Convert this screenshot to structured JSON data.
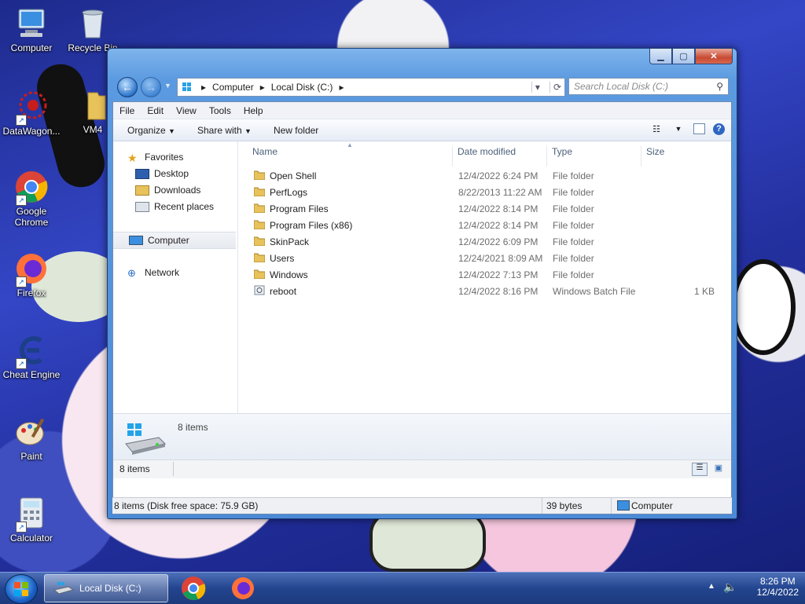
{
  "desktop": {
    "icons": [
      {
        "label": "Computer"
      },
      {
        "label": "Recycle Bin"
      },
      {
        "label": "DataWagon..."
      },
      {
        "label": "VM4"
      },
      {
        "label": "Google Chrome"
      },
      {
        "label": "Firefox"
      },
      {
        "label": "Cheat Engine"
      },
      {
        "label": "Paint"
      },
      {
        "label": "Calculator"
      }
    ]
  },
  "window": {
    "address": {
      "segments": [
        "Computer",
        "Local Disk (C:)"
      ]
    },
    "search_placeholder": "Search Local Disk (C:)",
    "menu": [
      "File",
      "Edit",
      "View",
      "Tools",
      "Help"
    ],
    "toolbar": {
      "organize": "Organize",
      "share_with": "Share with",
      "new_folder": "New folder"
    },
    "nav": {
      "favorites": "Favorites",
      "desktop": "Desktop",
      "downloads": "Downloads",
      "recent": "Recent places",
      "computer": "Computer",
      "network": "Network"
    },
    "columns": {
      "name": "Name",
      "date": "Date modified",
      "type": "Type",
      "size": "Size"
    },
    "files": [
      {
        "name": "Open Shell",
        "date": "12/4/2022 6:24 PM",
        "type": "File folder",
        "size": ""
      },
      {
        "name": "PerfLogs",
        "date": "8/22/2013 11:22 AM",
        "type": "File folder",
        "size": ""
      },
      {
        "name": "Program Files",
        "date": "12/4/2022 8:14 PM",
        "type": "File folder",
        "size": ""
      },
      {
        "name": "Program Files (x86)",
        "date": "12/4/2022 8:14 PM",
        "type": "File folder",
        "size": ""
      },
      {
        "name": "SkinPack",
        "date": "12/4/2022 6:09 PM",
        "type": "File folder",
        "size": ""
      },
      {
        "name": "Users",
        "date": "12/24/2021 8:09 AM",
        "type": "File folder",
        "size": ""
      },
      {
        "name": "Windows",
        "date": "12/4/2022 7:13 PM",
        "type": "File folder",
        "size": ""
      },
      {
        "name": "reboot",
        "date": "12/4/2022 8:16 PM",
        "type": "Windows Batch File",
        "size": "1 KB"
      }
    ],
    "details_count": "8 items",
    "strip_count": "8 items",
    "status": {
      "summary": "8 items (Disk free space: 75.9 GB)",
      "bytes": "39 bytes",
      "location": "Computer"
    }
  },
  "taskbar": {
    "task_label": "Local Disk (C:)",
    "time": "8:26 PM",
    "date": "12/4/2022"
  },
  "colors": {
    "folder": "#e8c25a",
    "accent": "#3c86d8"
  }
}
